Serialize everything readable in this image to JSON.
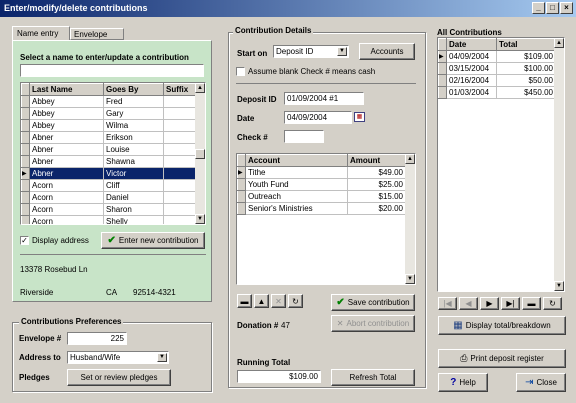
{
  "window": {
    "title": "Enter/modify/delete contributions"
  },
  "tabs": {
    "name_entry": "Name entry",
    "envelope_entry": "Envelope entry"
  },
  "names": {
    "prompt": "Select a name to enter/update a contribution",
    "search_value": "",
    "columns": [
      "Last Name",
      "Goes By",
      "Suffix"
    ],
    "rows": [
      [
        "Abbey",
        "Fred",
        ""
      ],
      [
        "Abbey",
        "Gary",
        ""
      ],
      [
        "Abbey",
        "Wilma",
        ""
      ],
      [
        "Abner",
        "Erikson",
        ""
      ],
      [
        "Abner",
        "Louise",
        ""
      ],
      [
        "Abner",
        "Shawna",
        ""
      ],
      [
        "Abner",
        "Victor",
        ""
      ],
      [
        "Acorn",
        "Cliff",
        ""
      ],
      [
        "Acorn",
        "Daniel",
        ""
      ],
      [
        "Acorn",
        "Sharon",
        ""
      ],
      [
        "Acorn",
        "Shelly",
        ""
      ]
    ],
    "selected_index": 6,
    "display_address_label": "Display address",
    "display_address_checked": true,
    "enter_new_label": "Enter new contribution",
    "address_line": "13378 Rosebud Ln",
    "city": "Riverside",
    "state": "CA",
    "zip": "92514-4321"
  },
  "prefs": {
    "title": "Contributions Preferences",
    "envelope_label": "Envelope #",
    "envelope_value": "225",
    "address_to_label": "Address to",
    "address_to_value": "Husband/Wife",
    "pledges_label": "Pledges",
    "pledges_button": "Set or review pledges"
  },
  "details": {
    "title": "Contribution Details",
    "start_on_label": "Start on",
    "start_on_value": "Deposit ID",
    "accounts_button": "Accounts",
    "assume_blank_label": "Assume blank Check # means cash",
    "assume_blank_checked": false,
    "deposit_id_label": "Deposit ID",
    "deposit_id_value": "01/09/2004 #1",
    "date_label": "Date",
    "date_value": "04/09/2004",
    "check_label": "Check #",
    "check_value": "",
    "columns": [
      "Account",
      "Amount"
    ],
    "rows": [
      [
        "Tithe",
        "$49.00"
      ],
      [
        "Youth Fund",
        "$25.00"
      ],
      [
        "Outreach",
        "$15.00"
      ],
      [
        "Senior's Ministries",
        "$20.00"
      ]
    ],
    "save_label": "Save contribution",
    "abort_label": "Abort contribution",
    "donation_label": "Donation #",
    "donation_value": "47",
    "running_total_label": "Running Total",
    "running_total_value": "$109.00",
    "refresh_label": "Refresh Total"
  },
  "all": {
    "title": "All Contributions",
    "columns": [
      "Date",
      "Total"
    ],
    "rows": [
      [
        "04/09/2004",
        "$109.00"
      ],
      [
        "03/15/2004",
        "$100.00"
      ],
      [
        "02/16/2004",
        "$50.00"
      ],
      [
        "01/03/2004",
        "$450.00"
      ]
    ],
    "display_total_label": "Display total/breakdown",
    "print_label": "Print deposit register",
    "help_label": "Help",
    "close_label": "Close"
  },
  "colors": {
    "accent": "#0a246a",
    "panel_green": "#c8e4c8"
  }
}
